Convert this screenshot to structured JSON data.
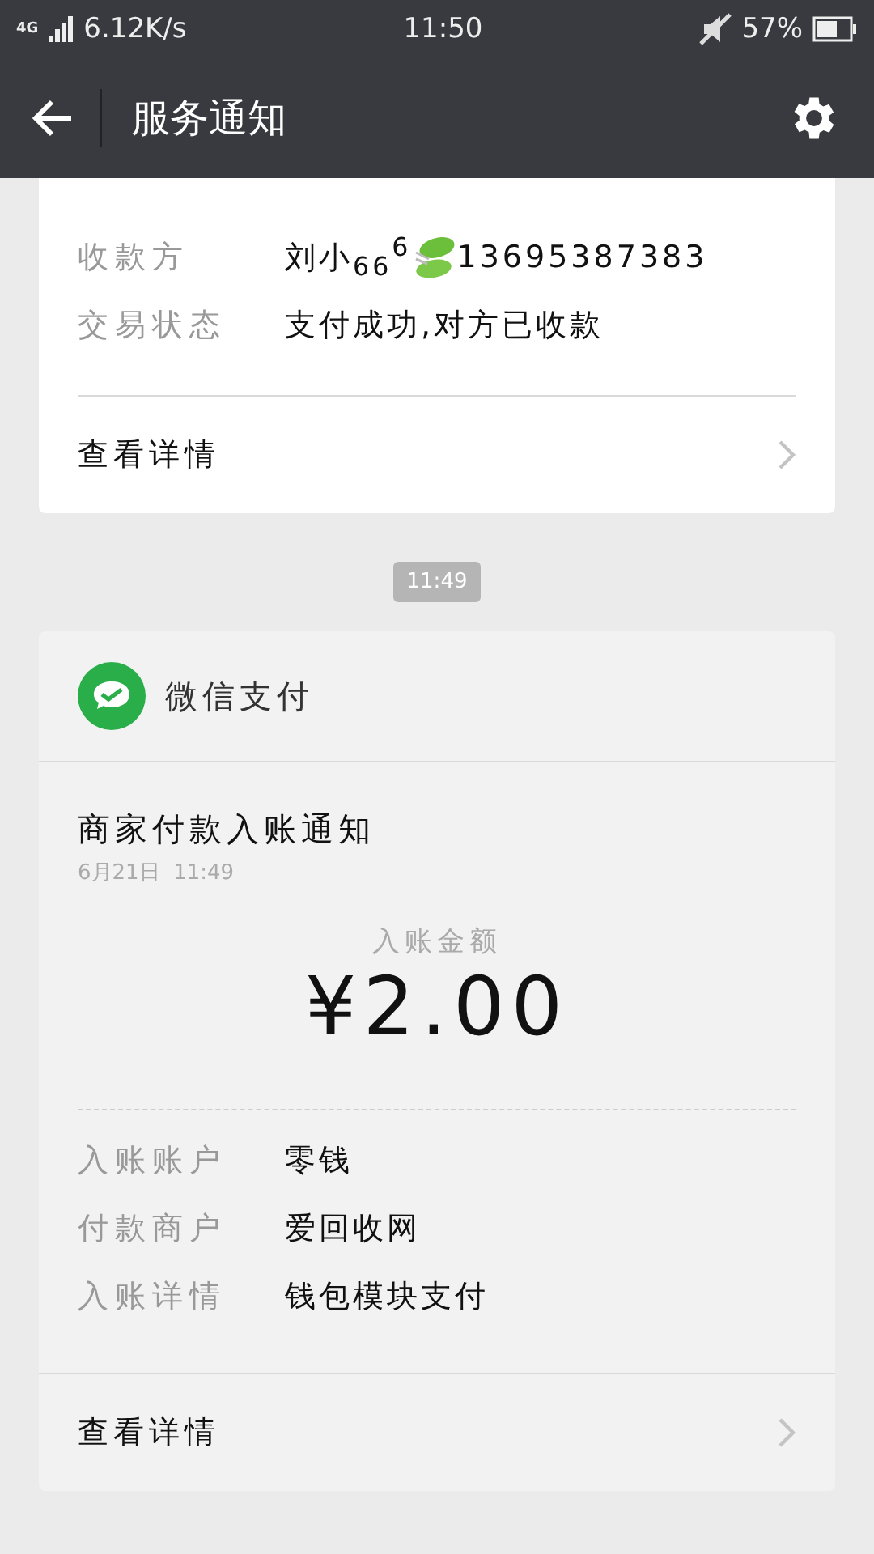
{
  "status_bar": {
    "network": "4G",
    "speed": "6.12K/s",
    "time": "11:50",
    "battery": "57%"
  },
  "header": {
    "title": "服务通知"
  },
  "cards": [
    {
      "fields": [
        {
          "label": "收款方",
          "value": "刘小$_{66}$$^{6}$",
          "leaf": true,
          "suffix": "13695387383"
        },
        {
          "label": "交易状态",
          "value": "支付成功,对方已收款",
          "leaf": false
        }
      ],
      "details": "查看详情"
    },
    {
      "timestamp": "11:49",
      "source": "微信支付",
      "title": "商家付款入账通知",
      "date": "6月21日  11:49",
      "amount_label": "入账金额",
      "amount": "¥2.00",
      "fields": [
        {
          "label": "入账账户",
          "value": "零钱",
          "leaf": false
        },
        {
          "label": "付款商户",
          "value": "爱回收网",
          "leaf": false
        },
        {
          "label": "入账详情",
          "value": "钱包模块支付",
          "leaf": false
        }
      ],
      "details": "查看详情"
    }
  ]
}
